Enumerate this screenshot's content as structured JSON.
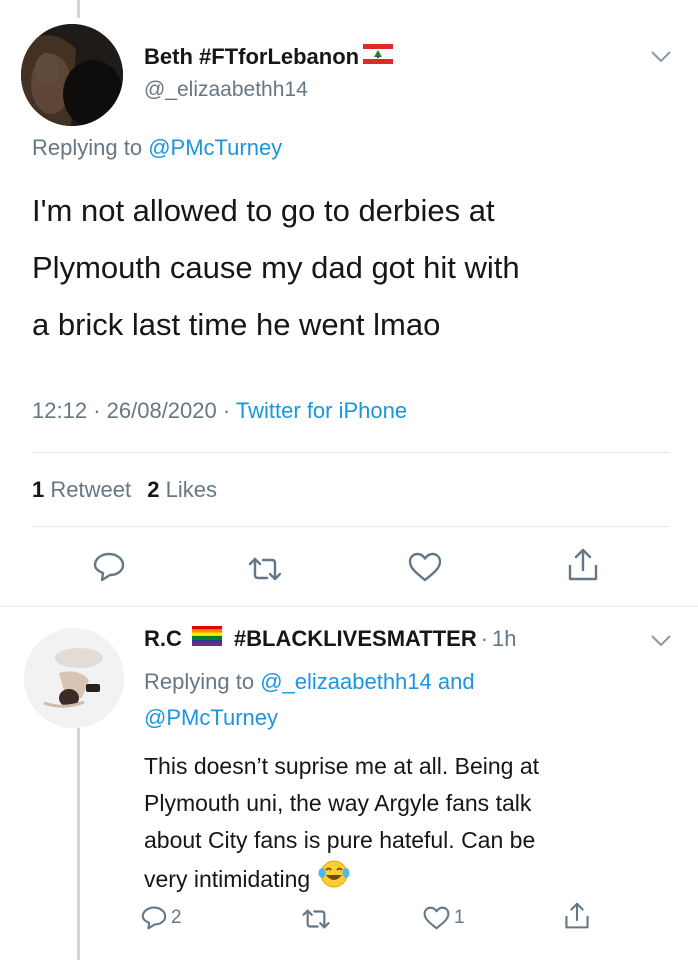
{
  "tweet": {
    "display_name": "Beth #FTforLebanon",
    "handle": "@_elizaabethh14",
    "reply_prefix": "Replying to ",
    "reply_to": "@PMcTurney",
    "text_lines": [
      "I'm not allowed to go to derbies at",
      "Plymouth cause my dad got hit with",
      "a brick last time he went lmao"
    ],
    "time": "12:12",
    "date": "26/08/2020",
    "source": "Twitter for iPhone",
    "retweet_count": "1",
    "retweet_label": "Retweet",
    "like_count": "2",
    "like_label": "Likes",
    "flag_icon": "lebanon-flag-icon"
  },
  "reply": {
    "display_name": "R.C",
    "hashtag": "#BLACKLIVESMATTER",
    "time_ago": "1h",
    "reply_prefix": "Replying to ",
    "reply_to_1": "@_elizaabethh14",
    "reply_and": " and",
    "reply_to_2": "@PMcTurney",
    "text_lines": [
      "This doesn’t suprise me at all. Being at",
      "Plymouth uni, the way Argyle fans talk",
      "about City fans is pure hateful. Can be",
      "very intimidating"
    ],
    "reply_count": "2",
    "like_count": "1",
    "flag_icon": "rainbow-flag-icon",
    "emoji_icon": "tears-of-joy-emoji-icon"
  },
  "colors": {
    "link": "#1b95e0",
    "secondary": "#657786",
    "primary": "#14171a",
    "divider": "#e1e8ed",
    "thread_line": "#cdd6dd"
  }
}
